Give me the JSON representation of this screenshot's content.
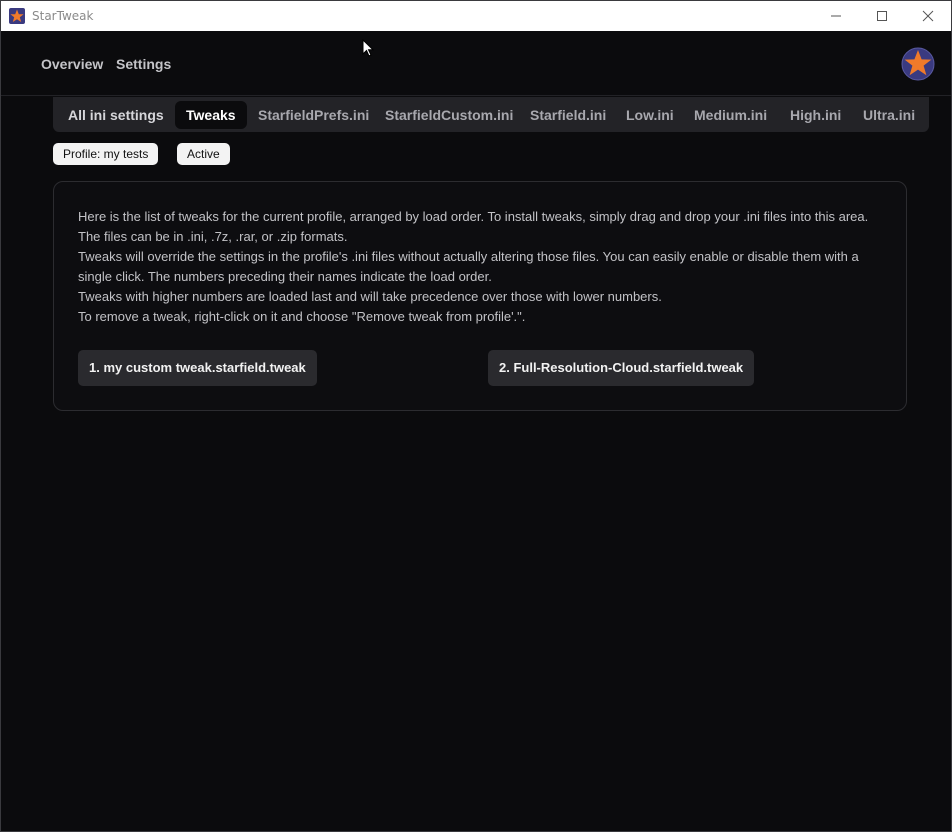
{
  "window": {
    "title": "StarTweak"
  },
  "nav": {
    "overview": "Overview",
    "settings": "Settings"
  },
  "tabs": [
    {
      "label": "All ini settings"
    },
    {
      "label": "Tweaks"
    },
    {
      "label": "StarfieldPrefs.ini"
    },
    {
      "label": "StarfieldCustom.ini"
    },
    {
      "label": "Starfield.ini"
    },
    {
      "label": "Low.ini"
    },
    {
      "label": "Medium.ini"
    },
    {
      "label": "High.ini"
    },
    {
      "label": "Ultra.ini"
    }
  ],
  "active_tab": "Tweaks",
  "profile": {
    "label": "Profile: my tests",
    "status": "Active"
  },
  "description": [
    "Here is the list of tweaks for the current profile, arranged by load order. To install tweaks, simply drag and drop your .ini files into this area. The files can be in .ini, .7z, .rar, or .zip formats.",
    "Tweaks will override the settings in the profile's .ini files without actually altering those files. You can easily enable or disable them with a single click. The numbers preceding their names indicate the load order.",
    "Tweaks with higher numbers are loaded last and will take precedence over those with lower numbers.",
    "To remove a tweak, right-click on it and choose \"Remove tweak from profile'.\"."
  ],
  "tweaks": [
    {
      "label": "1. my custom tweak.starfield.tweak"
    },
    {
      "label": "2. Full-Resolution-Cloud.starfield.tweak"
    }
  ],
  "colors": {
    "background": "#0b0b0d",
    "tab_bar": "#232327",
    "tweak_button": "#2a2a2e",
    "star_orange": "#f07a2a",
    "avatar_bg": "#3a3a80"
  },
  "icons": {
    "app": "star-icon",
    "avatar": "star-avatar-icon",
    "minimize": "minimize-icon",
    "maximize": "maximize-icon",
    "close": "close-icon",
    "cursor": "mouse-pointer-icon"
  }
}
